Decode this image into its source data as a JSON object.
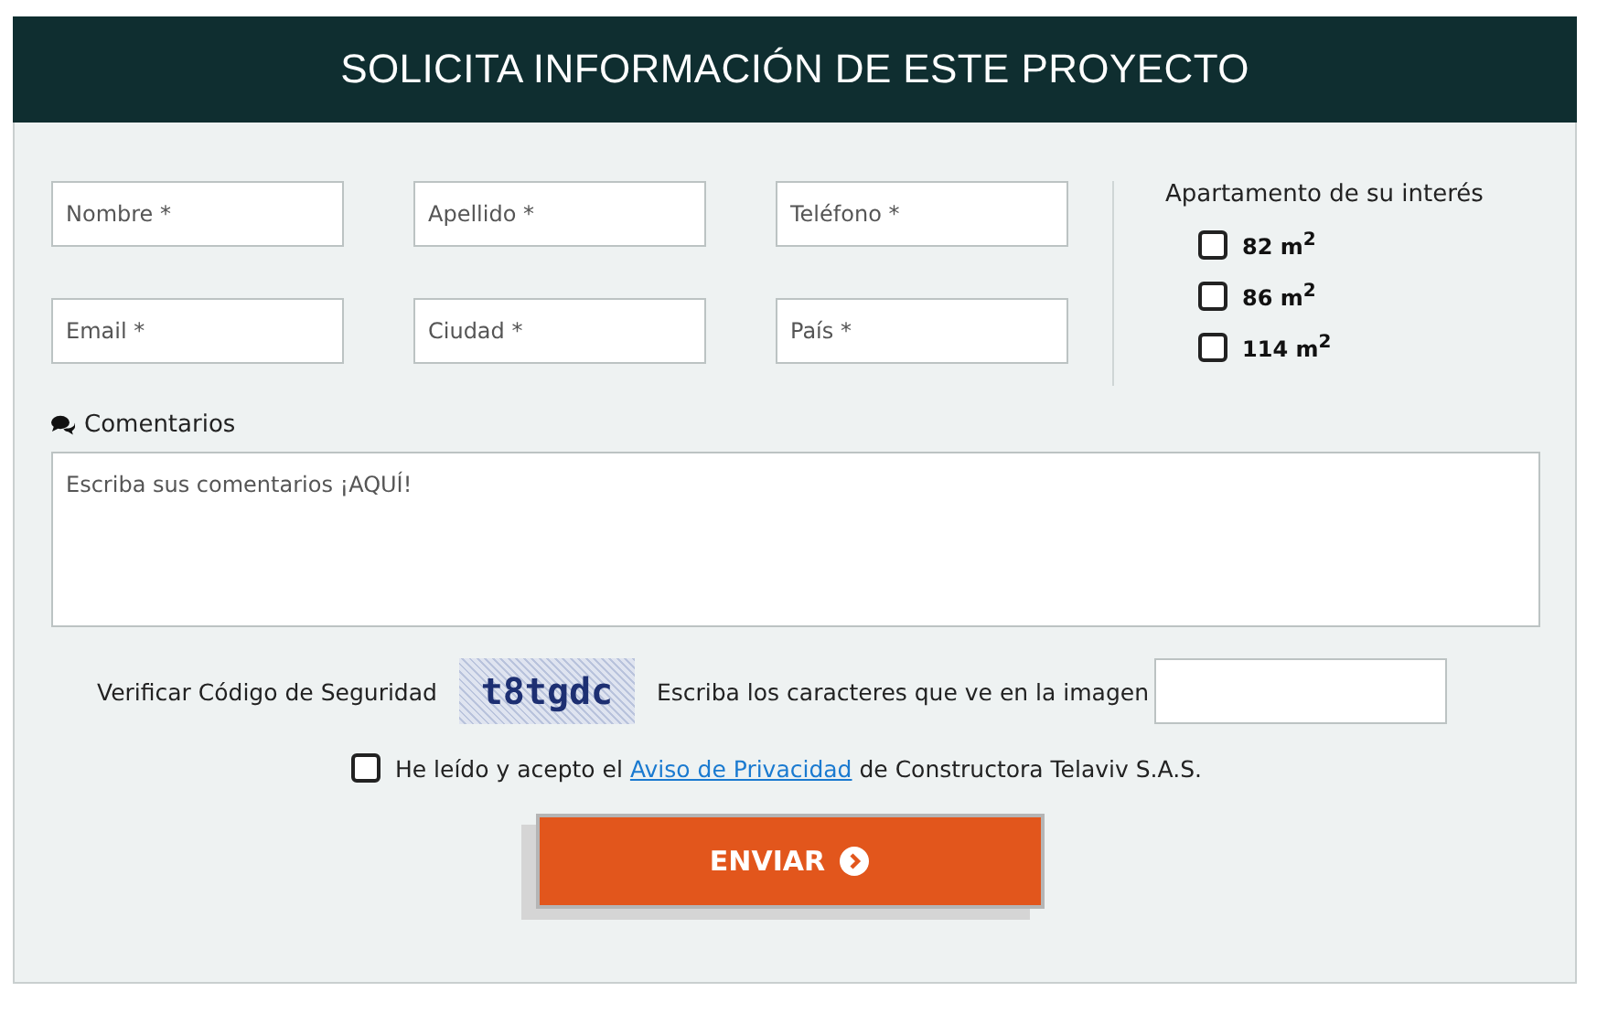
{
  "header": {
    "title": "SOLICITA INFORMACIÓN DE ESTE PROYECTO"
  },
  "fields": [
    {
      "placeholder": "Nombre *"
    },
    {
      "placeholder": "Apellido *"
    },
    {
      "placeholder": "Teléfono *"
    },
    {
      "placeholder": "Email *"
    },
    {
      "placeholder": "Ciudad *"
    },
    {
      "placeholder": "País *"
    }
  ],
  "apartments": {
    "label": "Apartamento de su interés",
    "options": [
      {
        "label": "82 m$^{2}$",
        "checked": false
      },
      {
        "label": "86 m$^{2}$",
        "checked": false
      },
      {
        "label": "114 m$^{2}$",
        "checked": false
      }
    ]
  },
  "comments": {
    "label": "Comentarios",
    "placeholder": "Escriba sus comentarios ¡AQUÍ!"
  },
  "captcha": {
    "label": "Verificar Código de Seguridad",
    "code": "t8tgdc",
    "prompt": "Escriba los caracteres que ve en la imagen"
  },
  "consent": {
    "checked": false,
    "before": "He leído y acepto el",
    "link": "Aviso de Privacidad",
    "after": "de Constructora Telaviv S.A.S."
  },
  "submit": {
    "label": "ENVIAR"
  }
}
